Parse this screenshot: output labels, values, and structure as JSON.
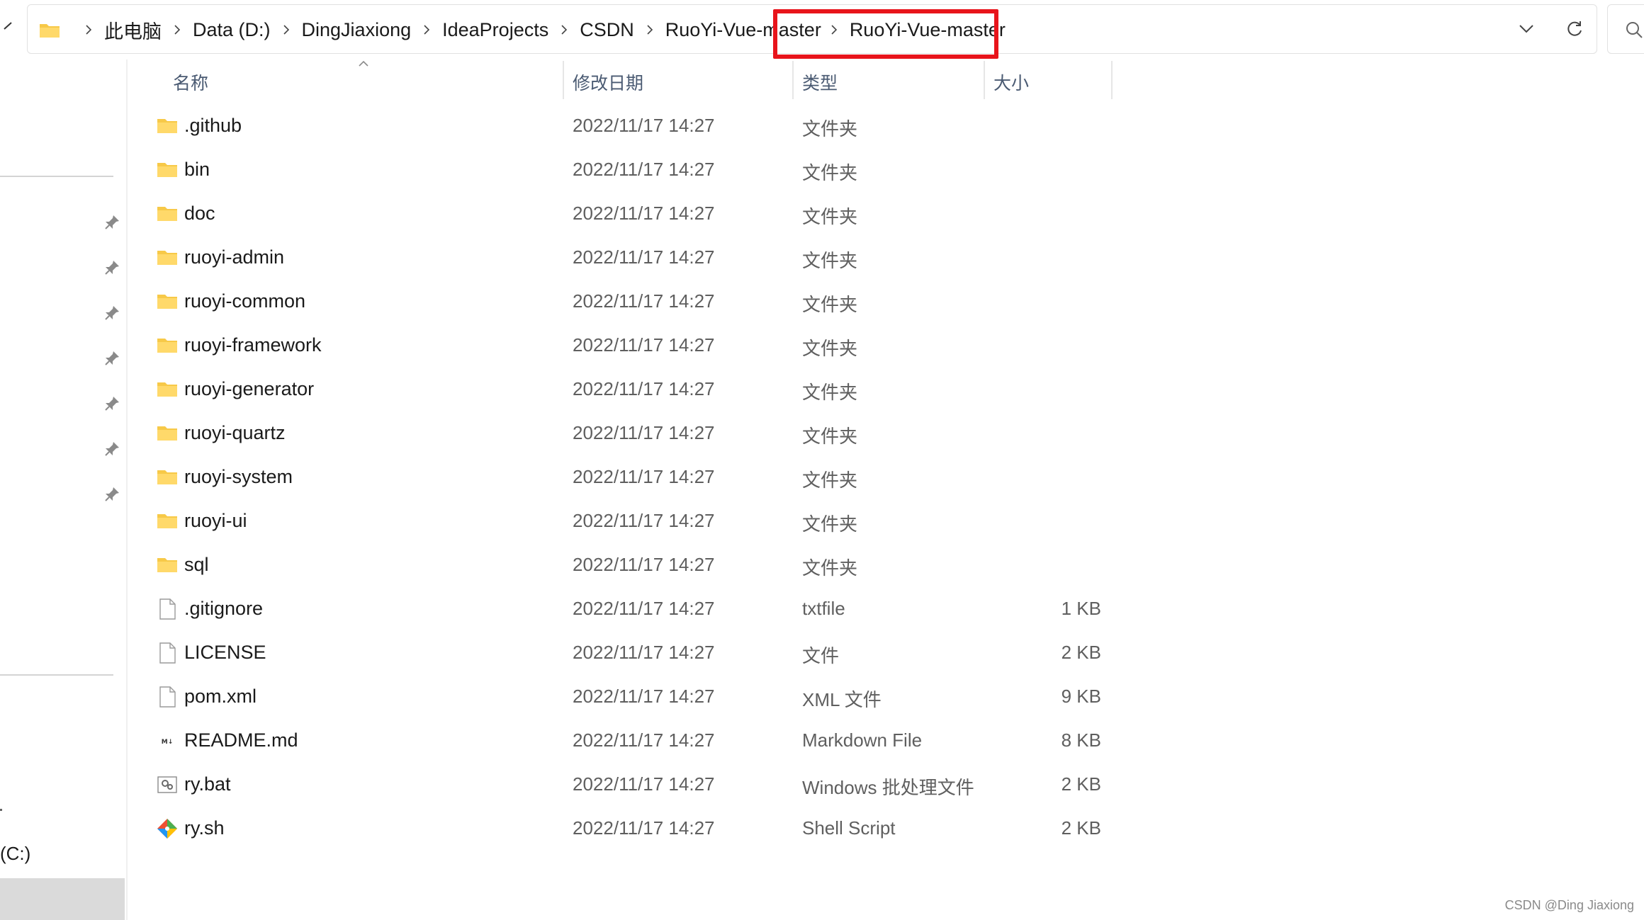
{
  "address_bar": {
    "breadcrumbs": [
      "此电脑",
      "Data (D:)",
      "DingJiaxiong",
      "IdeaProjects",
      "CSDN",
      "RuoYi-Vue-master",
      "RuoYi-Vue-master"
    ],
    "highlight_color": "#e8141b"
  },
  "columns": {
    "name": "名称",
    "date": "修改日期",
    "type": "类型",
    "size": "大小"
  },
  "nav": {
    "drive_label": "(C:)",
    "pinned_count": 7
  },
  "files": [
    {
      "name": ".github",
      "date": "2022/11/17 14:27",
      "type": "文件夹",
      "size": "",
      "icon": "folder-icon"
    },
    {
      "name": "bin",
      "date": "2022/11/17 14:27",
      "type": "文件夹",
      "size": "",
      "icon": "folder-icon"
    },
    {
      "name": "doc",
      "date": "2022/11/17 14:27",
      "type": "文件夹",
      "size": "",
      "icon": "folder-icon"
    },
    {
      "name": "ruoyi-admin",
      "date": "2022/11/17 14:27",
      "type": "文件夹",
      "size": "",
      "icon": "folder-icon"
    },
    {
      "name": "ruoyi-common",
      "date": "2022/11/17 14:27",
      "type": "文件夹",
      "size": "",
      "icon": "folder-icon"
    },
    {
      "name": "ruoyi-framework",
      "date": "2022/11/17 14:27",
      "type": "文件夹",
      "size": "",
      "icon": "folder-icon"
    },
    {
      "name": "ruoyi-generator",
      "date": "2022/11/17 14:27",
      "type": "文件夹",
      "size": "",
      "icon": "folder-icon"
    },
    {
      "name": "ruoyi-quartz",
      "date": "2022/11/17 14:27",
      "type": "文件夹",
      "size": "",
      "icon": "folder-icon"
    },
    {
      "name": "ruoyi-system",
      "date": "2022/11/17 14:27",
      "type": "文件夹",
      "size": "",
      "icon": "folder-icon"
    },
    {
      "name": "ruoyi-ui",
      "date": "2022/11/17 14:27",
      "type": "文件夹",
      "size": "",
      "icon": "folder-icon"
    },
    {
      "name": "sql",
      "date": "2022/11/17 14:27",
      "type": "文件夹",
      "size": "",
      "icon": "folder-icon"
    },
    {
      "name": ".gitignore",
      "date": "2022/11/17 14:27",
      "type": "txtfile",
      "size": "1 KB",
      "icon": "file-icon"
    },
    {
      "name": "LICENSE",
      "date": "2022/11/17 14:27",
      "type": "文件",
      "size": "2 KB",
      "icon": "file-icon"
    },
    {
      "name": "pom.xml",
      "date": "2022/11/17 14:27",
      "type": "XML 文件",
      "size": "9 KB",
      "icon": "file-icon"
    },
    {
      "name": "README.md",
      "date": "2022/11/17 14:27",
      "type": "Markdown File",
      "size": "8 KB",
      "icon": "markdown-icon"
    },
    {
      "name": "ry.bat",
      "date": "2022/11/17 14:27",
      "type": "Windows 批处理文件",
      "size": "2 KB",
      "icon": "batch-file-icon"
    },
    {
      "name": "ry.sh",
      "date": "2022/11/17 14:27",
      "type": "Shell Script",
      "size": "2 KB",
      "icon": "git-script-icon"
    }
  ],
  "watermark": "CSDN @Ding Jiaxiong",
  "colors": {
    "folder": "#f7c948",
    "header_text": "#4a5a72",
    "secondary_text": "#5f5f5f"
  }
}
